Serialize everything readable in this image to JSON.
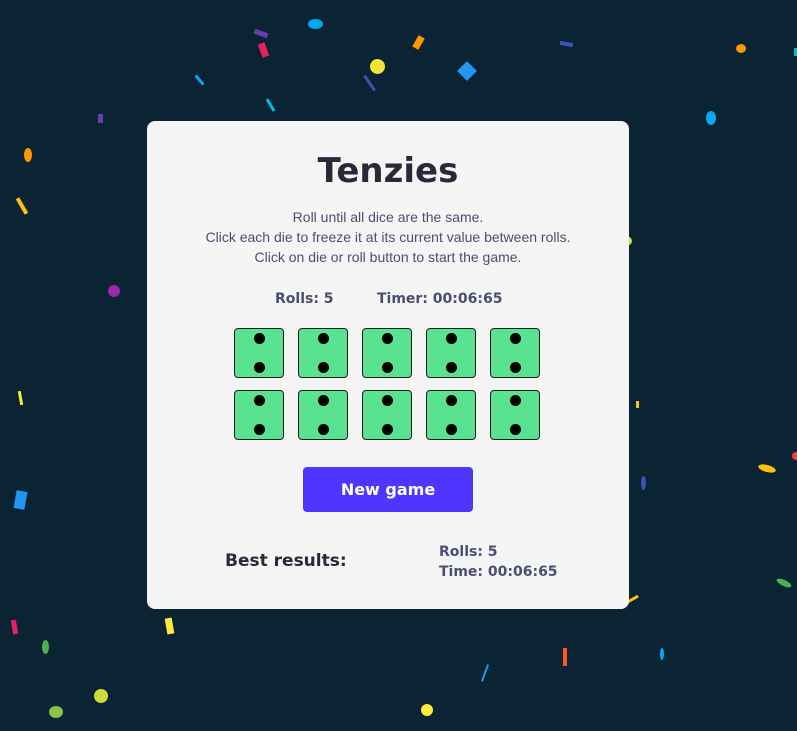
{
  "game": {
    "title": "Tenzies",
    "instructions": [
      "Roll until all dice are the same.",
      "Click each die to freeze it at its current value between rolls.",
      "Click on die or roll button to start the game."
    ],
    "rolls_label": "Rolls: 5",
    "timer_label": "Timer: 00:06:65",
    "dice_values": [
      2,
      2,
      2,
      2,
      2,
      2,
      2,
      2,
      2,
      2
    ],
    "new_game_label": "New game",
    "best_results_label": "Best results:",
    "best_rolls": "Rolls: 5",
    "best_time": "Time: 00:06:65"
  },
  "colors": {
    "background": "#0b2434",
    "card": "#f5f5f5",
    "die_fill": "#59e391",
    "button": "#5035ff"
  }
}
